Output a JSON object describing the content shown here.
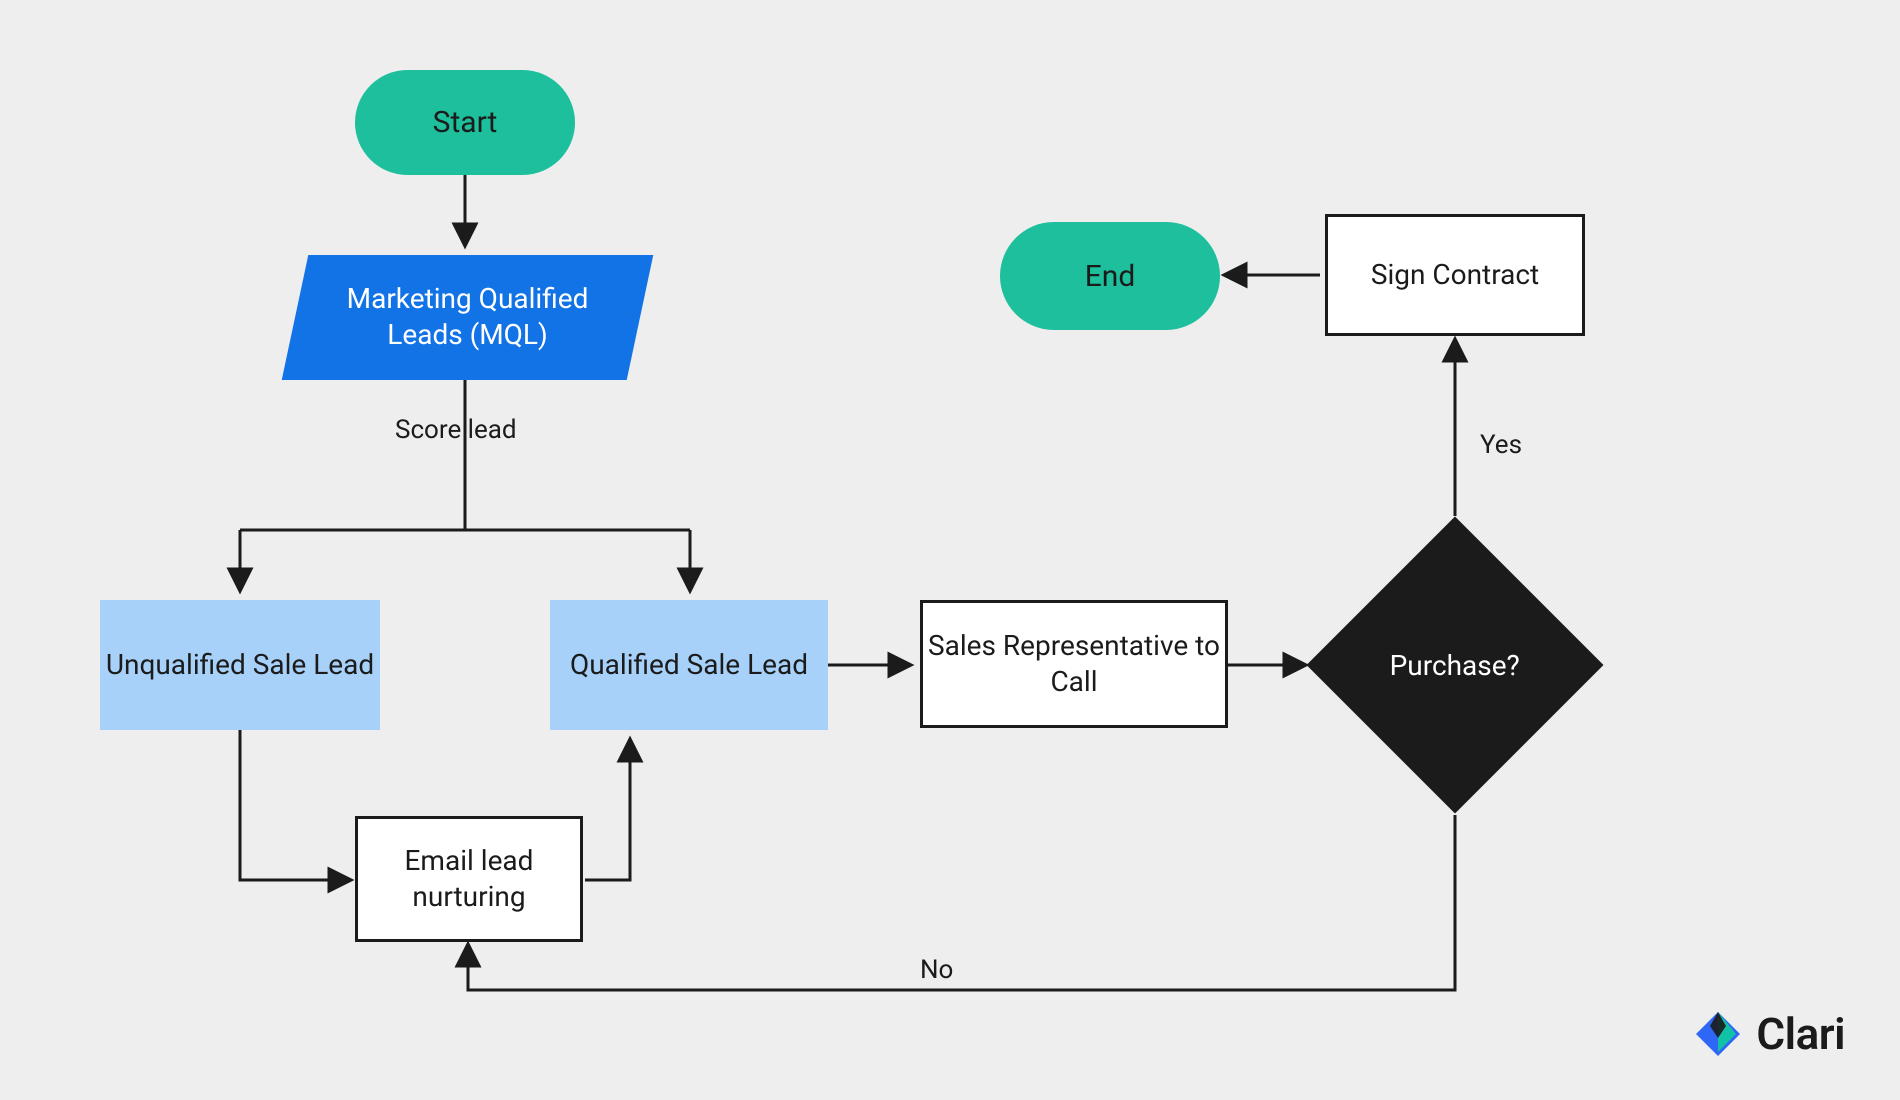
{
  "colors": {
    "bg": "#eeeeee",
    "terminator": "#1dbf9c",
    "data": "#1273e6",
    "process_light": "#a7d1f8",
    "process_white": "#ffffff",
    "decision": "#1b1b1b"
  },
  "nodes": {
    "start": {
      "label": "Start"
    },
    "mql": {
      "label": "Marketing Qualified Leads (MQL)"
    },
    "unqualified": {
      "label": "Unqualified Sale Lead"
    },
    "qualified": {
      "label": "Qualified Sale Lead"
    },
    "nurturing": {
      "label": "Email lead nurturing"
    },
    "sales_call": {
      "label": "Sales Representative to Call"
    },
    "purchase": {
      "label": "Purchase?"
    },
    "sign_contract": {
      "label": "Sign Contract"
    },
    "end": {
      "label": "End"
    }
  },
  "edges": {
    "score_lead": "Score lead",
    "yes": "Yes",
    "no": "No"
  },
  "brand": {
    "name": "Clari"
  }
}
